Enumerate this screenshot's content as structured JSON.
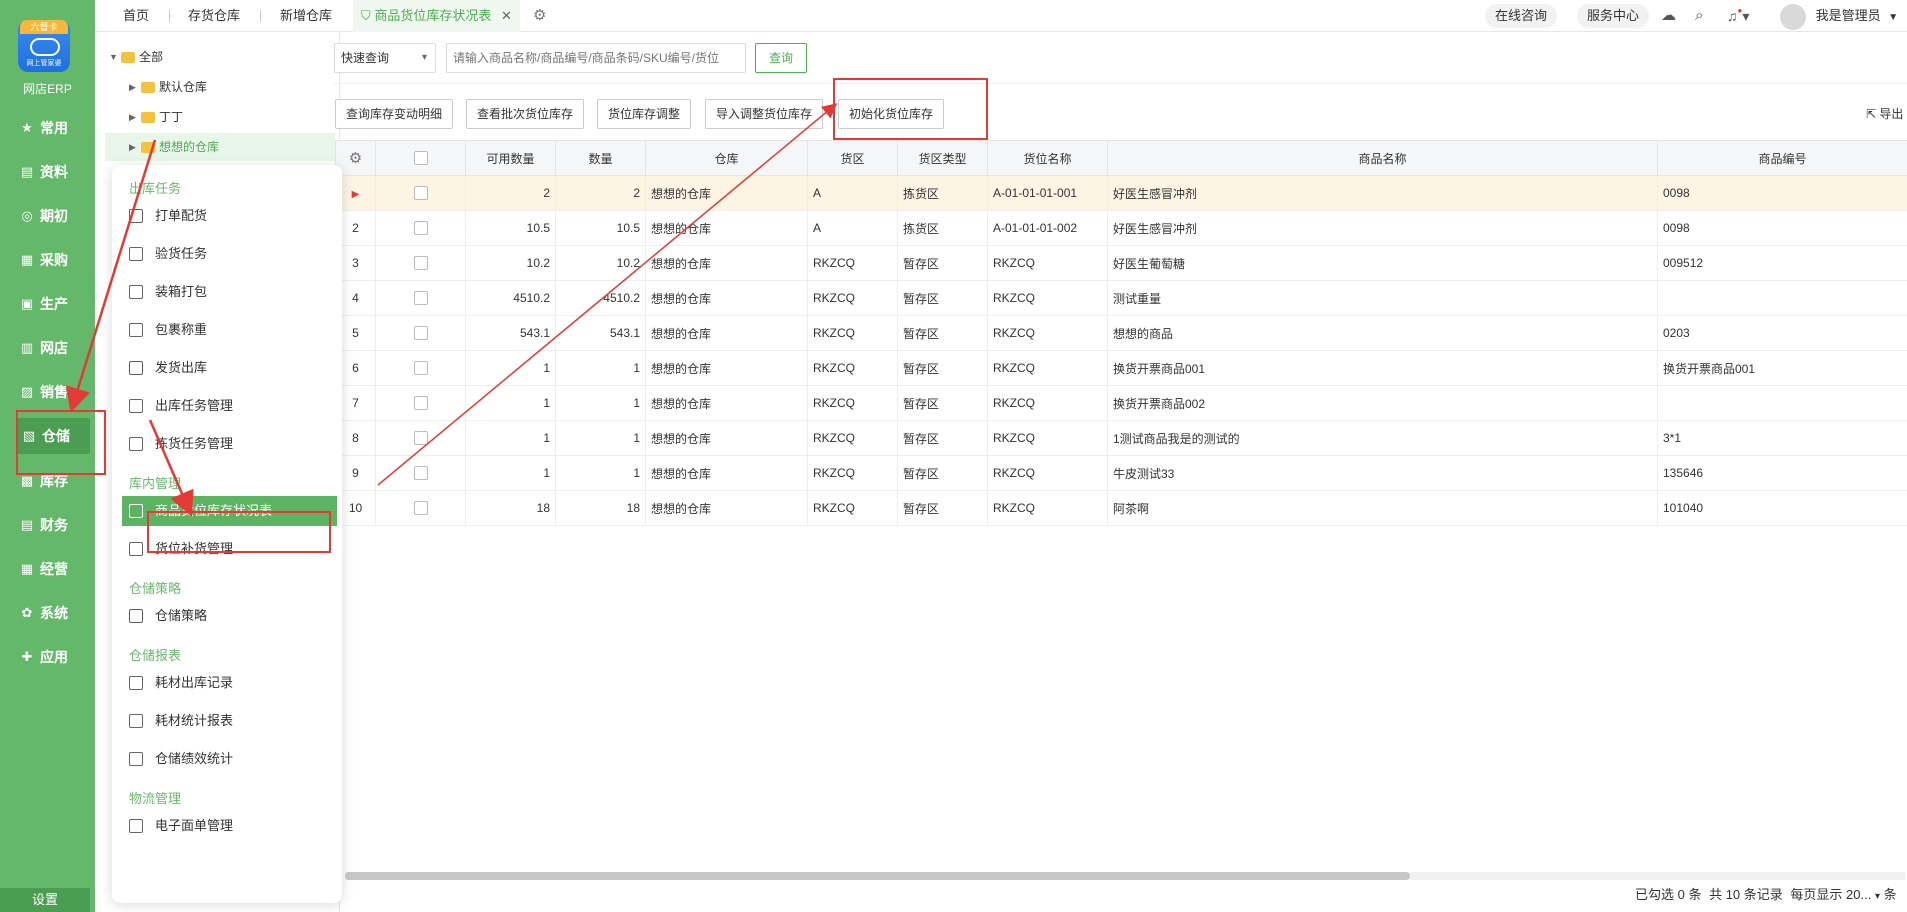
{
  "app": {
    "badge": "六督卡",
    "logo_sub": "网上管家婆",
    "name": "网店ERP"
  },
  "leftnav": [
    {
      "label": "常用",
      "icon": "star-icon",
      "glyph": "★"
    },
    {
      "label": "资料",
      "icon": "document-icon",
      "glyph": "▤"
    },
    {
      "label": "期初",
      "icon": "target-icon",
      "glyph": "◎"
    },
    {
      "label": "采购",
      "icon": "cart-icon",
      "glyph": "▦"
    },
    {
      "label": "生产",
      "icon": "factory-icon",
      "glyph": "▣"
    },
    {
      "label": "网店",
      "icon": "shop-icon",
      "glyph": "▥"
    },
    {
      "label": "销售",
      "icon": "chart-icon",
      "glyph": "▨"
    },
    {
      "label": "仓储",
      "icon": "warehouse-icon",
      "glyph": "▧"
    },
    {
      "label": "库存",
      "icon": "boxes-icon",
      "glyph": "▩"
    },
    {
      "label": "财务",
      "icon": "finance-icon",
      "glyph": "▤"
    },
    {
      "label": "经营",
      "icon": "business-icon",
      "glyph": "▦"
    },
    {
      "label": "系统",
      "icon": "gear-icon",
      "glyph": "✿"
    },
    {
      "label": "应用",
      "icon": "plus-icon",
      "glyph": "✚"
    }
  ],
  "settings_label": "设置",
  "tabs": {
    "home": "首页",
    "stock_warehouse": "存货仓库",
    "new_warehouse": "新增仓库",
    "active": "商品货位库存状况表",
    "close": "✕"
  },
  "topright": {
    "online": "在线咨询",
    "service": "服务中心",
    "user": "我是管理员"
  },
  "tree": {
    "root": "全部",
    "items": [
      "默认仓库",
      "丁丁",
      "想想的仓库"
    ]
  },
  "flyout": {
    "sections": [
      {
        "head": "出库任务",
        "items": [
          "打单配货",
          "验货任务",
          "装箱打包",
          "包裹称重",
          "发货出库",
          "出库任务管理",
          "拣货任务管理"
        ]
      },
      {
        "head": "库内管理",
        "items": [
          "商品货位库存状况表",
          "货位补货管理"
        ]
      },
      {
        "head": "仓储策略",
        "items": [
          "仓储策略"
        ]
      },
      {
        "head": "仓储报表",
        "items": [
          "耗材出库记录",
          "耗材统计报表",
          "仓储绩效统计"
        ]
      },
      {
        "head": "物流管理",
        "items": [
          "电子面单管理"
        ]
      }
    ]
  },
  "search": {
    "mode": "快速查询",
    "placeholder": "请输入商品名称/商品编号/商品条码/SKU编号/货位",
    "button": "查询"
  },
  "toolbar": [
    "查询库存变动明细",
    "查看批次货位库存",
    "货位库存调整",
    "导入调整货位库存",
    "初始化货位库存"
  ],
  "export_label": "导出",
  "table": {
    "headers": [
      "可用数量",
      "数量",
      "仓库",
      "货区",
      "货区类型",
      "货位名称",
      "商品名称",
      "商品编号"
    ],
    "rows": [
      {
        "no": "",
        "avail": "2",
        "qty": "2",
        "wh": "想想的仓库",
        "zone": "A",
        "ztype": "拣货区",
        "loc": "A-01-01-01-001",
        "name": "好医生感冒冲剂",
        "code": "0098"
      },
      {
        "no": "2",
        "avail": "10.5",
        "qty": "10.5",
        "wh": "想想的仓库",
        "zone": "A",
        "ztype": "拣货区",
        "loc": "A-01-01-01-002",
        "name": "好医生感冒冲剂",
        "code": "0098"
      },
      {
        "no": "3",
        "avail": "10.2",
        "qty": "10.2",
        "wh": "想想的仓库",
        "zone": "RKZCQ",
        "ztype": "暂存区",
        "loc": "RKZCQ",
        "name": "好医生葡萄糖",
        "code": "009512"
      },
      {
        "no": "4",
        "avail": "4510.2",
        "qty": "4510.2",
        "wh": "想想的仓库",
        "zone": "RKZCQ",
        "ztype": "暂存区",
        "loc": "RKZCQ",
        "name": "测试重量",
        "code": ""
      },
      {
        "no": "5",
        "avail": "543.1",
        "qty": "543.1",
        "wh": "想想的仓库",
        "zone": "RKZCQ",
        "ztype": "暂存区",
        "loc": "RKZCQ",
        "name": "想想的商品",
        "code": "0203"
      },
      {
        "no": "6",
        "avail": "1",
        "qty": "1",
        "wh": "想想的仓库",
        "zone": "RKZCQ",
        "ztype": "暂存区",
        "loc": "RKZCQ",
        "name": "换货开票商品001",
        "code": "换货开票商品001"
      },
      {
        "no": "7",
        "avail": "1",
        "qty": "1",
        "wh": "想想的仓库",
        "zone": "RKZCQ",
        "ztype": "暂存区",
        "loc": "RKZCQ",
        "name": "换货开票商品002",
        "code": ""
      },
      {
        "no": "8",
        "avail": "1",
        "qty": "1",
        "wh": "想想的仓库",
        "zone": "RKZCQ",
        "ztype": "暂存区",
        "loc": "RKZCQ",
        "name": "1测试商品我是的测试的",
        "code": "3*1"
      },
      {
        "no": "9",
        "avail": "1",
        "qty": "1",
        "wh": "想想的仓库",
        "zone": "RKZCQ",
        "ztype": "暂存区",
        "loc": "RKZCQ",
        "name": "牛皮测试33",
        "code": "135646"
      },
      {
        "no": "10",
        "avail": "18",
        "qty": "18",
        "wh": "想想的仓库",
        "zone": "RKZCQ",
        "ztype": "暂存区",
        "loc": "RKZCQ",
        "name": "阿茶啊",
        "code": "101040"
      }
    ]
  },
  "footer": {
    "selected": "已勾选 0 条",
    "total": "共 10 条记录",
    "per_page_label": "每页显示",
    "per_page": "20...",
    "unit": "条"
  },
  "colors": {
    "nav_green": "#64b86a",
    "accent": "#4caf50",
    "annotation_red": "#e53935"
  }
}
